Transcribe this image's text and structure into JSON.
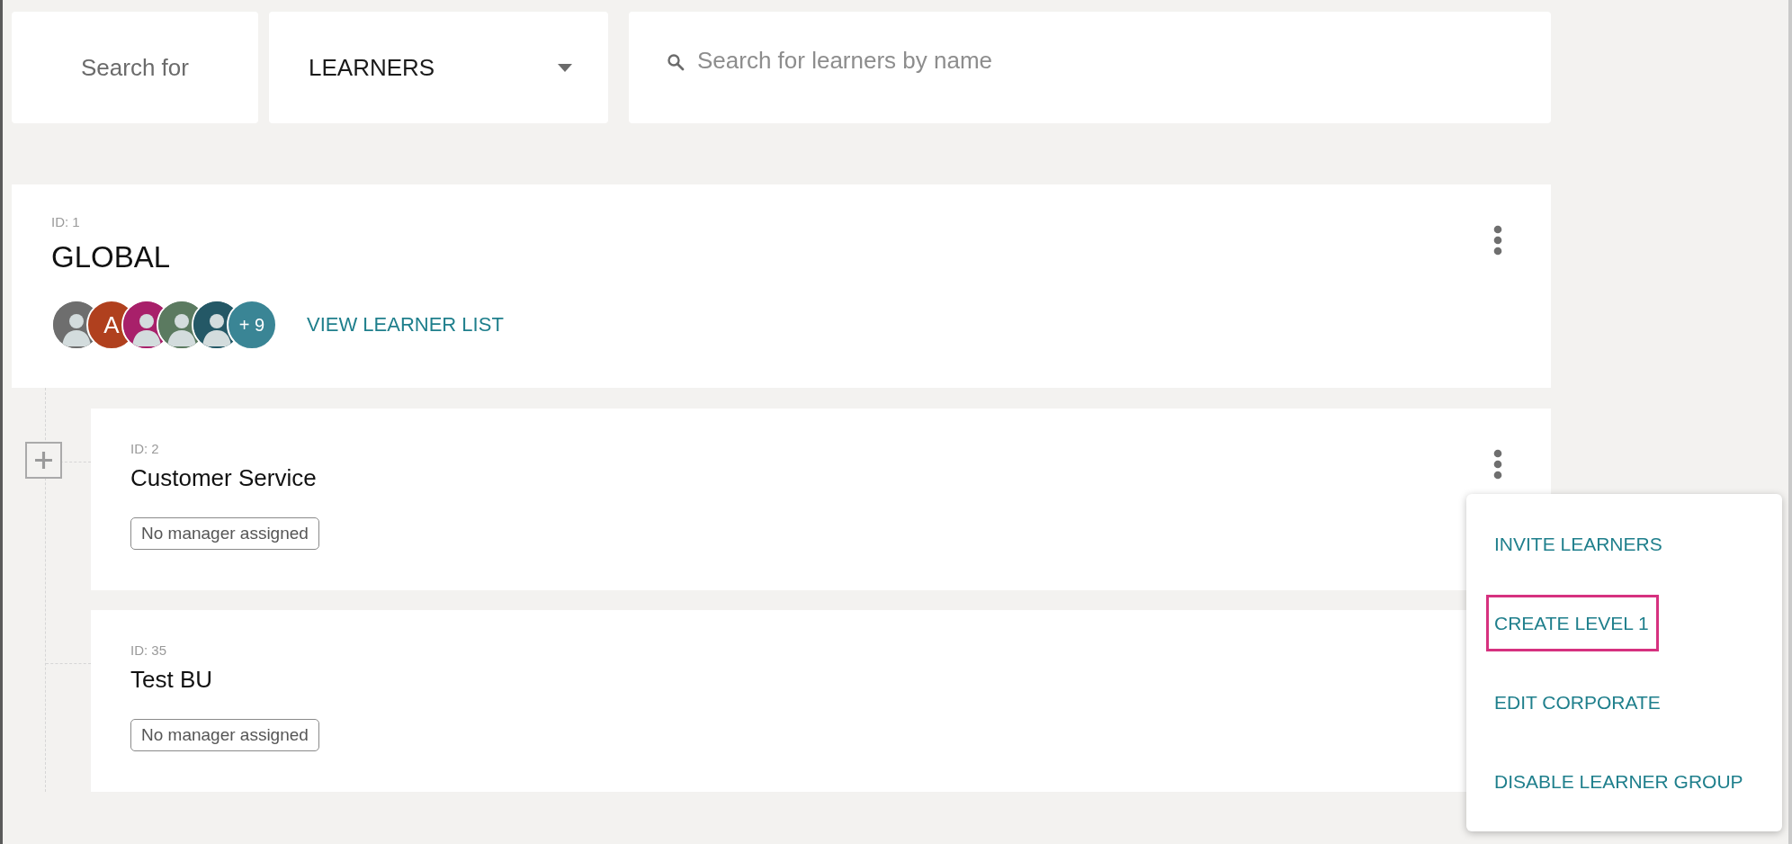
{
  "search_bar": {
    "label": "Search for",
    "type_select": {
      "value": "LEARNERS"
    },
    "search_field": {
      "placeholder": "Search for learners by name"
    }
  },
  "root_group": {
    "id_label": "ID: 1",
    "name": "GLOBAL",
    "avatars": [
      {
        "kind": "figure",
        "color": "#6e6e6e"
      },
      {
        "kind": "initial",
        "color": "#b0401e",
        "text": "A"
      },
      {
        "kind": "figure",
        "color": "#a8206a"
      },
      {
        "kind": "figure",
        "color": "#5b7a60"
      },
      {
        "kind": "figure",
        "color": "#245866"
      },
      {
        "kind": "count",
        "color": "#3a8595",
        "text": "+ 9"
      }
    ],
    "link": "VIEW LEARNER LIST",
    "children": [
      {
        "id_label": "ID: 2",
        "name": "Customer Service",
        "badge": "No manager assigned",
        "collapsed": true,
        "menu_button": true
      },
      {
        "id_label": "ID: 35",
        "name": "Test BU",
        "badge": "No manager assigned",
        "collapsed": false,
        "menu_button": false
      }
    ]
  },
  "context_menu": {
    "items": [
      {
        "label": "INVITE LEARNERS",
        "highlighted": false
      },
      {
        "label": "CREATE LEVEL 1",
        "highlighted": true
      },
      {
        "label": "EDIT CORPORATE",
        "highlighted": false
      },
      {
        "label": "DISABLE LEARNER GROUP",
        "highlighted": false
      }
    ]
  }
}
